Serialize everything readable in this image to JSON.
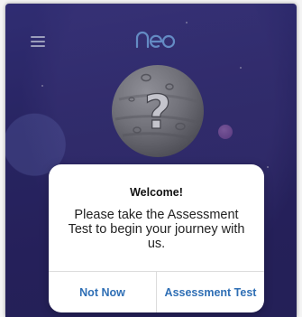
{
  "app": {
    "logo_text": "neo",
    "menu_icon": "hamburger-menu-icon",
    "mascot_icon": "question-mark-planet-icon"
  },
  "colors": {
    "background": "#2f2a72",
    "accent": "#2f6fb5",
    "logo": "#7fb3f5"
  },
  "dialog": {
    "title": "Welcome!",
    "message": "Please take the Assessment Test to begin your journey with us.",
    "buttons": {
      "not_now": "Not Now",
      "assessment_test": "Assessment Test"
    }
  }
}
